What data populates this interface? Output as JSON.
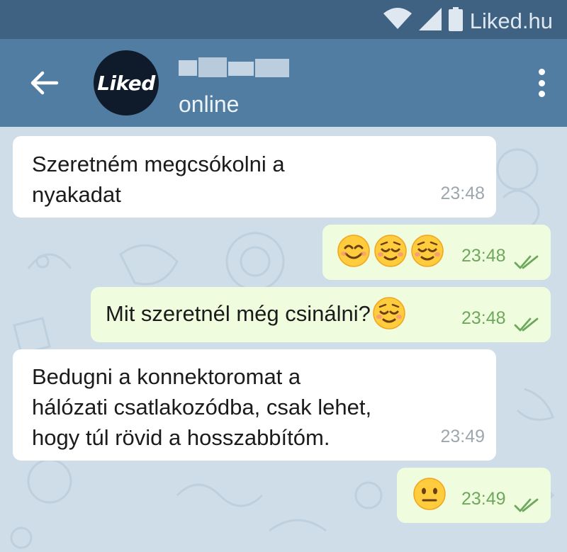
{
  "status_bar": {
    "carrier_watermark": "Liked.hu",
    "icons": [
      "wifi-icon",
      "signal-icon",
      "battery-icon"
    ]
  },
  "app_bar": {
    "avatar_text": "Liked",
    "contact_status": "online",
    "icons": [
      "back-arrow-icon",
      "more-vert-icon"
    ]
  },
  "messages": [
    {
      "direction": "in",
      "text": "Szeretném megcsókolni a\nnyakadat",
      "time": "23:48"
    },
    {
      "direction": "out",
      "text": "",
      "emojis": [
        "smiling-face-icon",
        "relieved-face-icon",
        "relieved-face-icon"
      ],
      "time": "23:48",
      "status": "read"
    },
    {
      "direction": "out",
      "text": "Mit szeretnél még csinálni?",
      "emojis": [
        "relieved-face-icon"
      ],
      "time": "23:48",
      "status": "read"
    },
    {
      "direction": "in",
      "text": "Bedugni a konnektoromat a\nhálózati csatlakozódba, csak lehet,\nhogy túl rövid a hosszabbítóm.",
      "time": "23:49"
    },
    {
      "direction": "out",
      "text": "",
      "emojis": [
        "neutral-face-icon"
      ],
      "time": "23:49",
      "status": "read"
    }
  ],
  "colors": {
    "status_bar": "#3f6283",
    "app_bar": "#527da3",
    "chat_background": "#cfdde8",
    "incoming_bubble": "#ffffff",
    "outgoing_bubble": "#effdde",
    "outgoing_time": "#6ea85d",
    "incoming_time": "#9ea7ae"
  }
}
